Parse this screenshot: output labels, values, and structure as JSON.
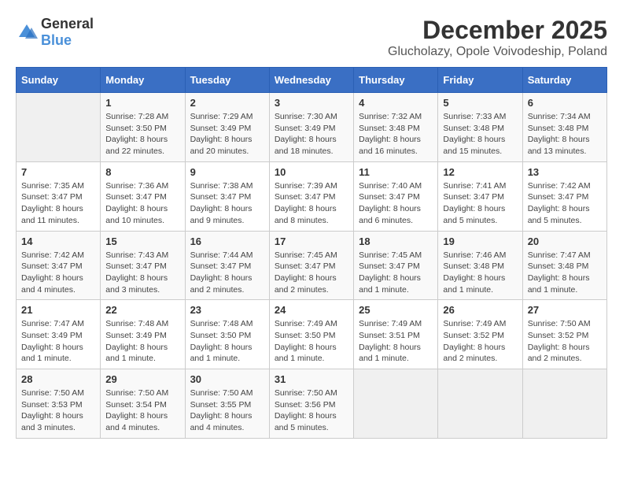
{
  "logo": {
    "general": "General",
    "blue": "Blue"
  },
  "header": {
    "month": "December 2025",
    "location": "Glucholazy, Opole Voivodeship, Poland"
  },
  "days_of_week": [
    "Sunday",
    "Monday",
    "Tuesday",
    "Wednesday",
    "Thursday",
    "Friday",
    "Saturday"
  ],
  "weeks": [
    [
      {
        "day": "",
        "info": ""
      },
      {
        "day": "1",
        "info": "Sunrise: 7:28 AM\nSunset: 3:50 PM\nDaylight: 8 hours and 22 minutes."
      },
      {
        "day": "2",
        "info": "Sunrise: 7:29 AM\nSunset: 3:49 PM\nDaylight: 8 hours and 20 minutes."
      },
      {
        "day": "3",
        "info": "Sunrise: 7:30 AM\nSunset: 3:49 PM\nDaylight: 8 hours and 18 minutes."
      },
      {
        "day": "4",
        "info": "Sunrise: 7:32 AM\nSunset: 3:48 PM\nDaylight: 8 hours and 16 minutes."
      },
      {
        "day": "5",
        "info": "Sunrise: 7:33 AM\nSunset: 3:48 PM\nDaylight: 8 hours and 15 minutes."
      },
      {
        "day": "6",
        "info": "Sunrise: 7:34 AM\nSunset: 3:48 PM\nDaylight: 8 hours and 13 minutes."
      }
    ],
    [
      {
        "day": "7",
        "info": "Sunrise: 7:35 AM\nSunset: 3:47 PM\nDaylight: 8 hours and 11 minutes."
      },
      {
        "day": "8",
        "info": "Sunrise: 7:36 AM\nSunset: 3:47 PM\nDaylight: 8 hours and 10 minutes."
      },
      {
        "day": "9",
        "info": "Sunrise: 7:38 AM\nSunset: 3:47 PM\nDaylight: 8 hours and 9 minutes."
      },
      {
        "day": "10",
        "info": "Sunrise: 7:39 AM\nSunset: 3:47 PM\nDaylight: 8 hours and 8 minutes."
      },
      {
        "day": "11",
        "info": "Sunrise: 7:40 AM\nSunset: 3:47 PM\nDaylight: 8 hours and 6 minutes."
      },
      {
        "day": "12",
        "info": "Sunrise: 7:41 AM\nSunset: 3:47 PM\nDaylight: 8 hours and 5 minutes."
      },
      {
        "day": "13",
        "info": "Sunrise: 7:42 AM\nSunset: 3:47 PM\nDaylight: 8 hours and 5 minutes."
      }
    ],
    [
      {
        "day": "14",
        "info": "Sunrise: 7:42 AM\nSunset: 3:47 PM\nDaylight: 8 hours and 4 minutes."
      },
      {
        "day": "15",
        "info": "Sunrise: 7:43 AM\nSunset: 3:47 PM\nDaylight: 8 hours and 3 minutes."
      },
      {
        "day": "16",
        "info": "Sunrise: 7:44 AM\nSunset: 3:47 PM\nDaylight: 8 hours and 2 minutes."
      },
      {
        "day": "17",
        "info": "Sunrise: 7:45 AM\nSunset: 3:47 PM\nDaylight: 8 hours and 2 minutes."
      },
      {
        "day": "18",
        "info": "Sunrise: 7:45 AM\nSunset: 3:47 PM\nDaylight: 8 hours and 1 minute."
      },
      {
        "day": "19",
        "info": "Sunrise: 7:46 AM\nSunset: 3:48 PM\nDaylight: 8 hours and 1 minute."
      },
      {
        "day": "20",
        "info": "Sunrise: 7:47 AM\nSunset: 3:48 PM\nDaylight: 8 hours and 1 minute."
      }
    ],
    [
      {
        "day": "21",
        "info": "Sunrise: 7:47 AM\nSunset: 3:49 PM\nDaylight: 8 hours and 1 minute."
      },
      {
        "day": "22",
        "info": "Sunrise: 7:48 AM\nSunset: 3:49 PM\nDaylight: 8 hours and 1 minute."
      },
      {
        "day": "23",
        "info": "Sunrise: 7:48 AM\nSunset: 3:50 PM\nDaylight: 8 hours and 1 minute."
      },
      {
        "day": "24",
        "info": "Sunrise: 7:49 AM\nSunset: 3:50 PM\nDaylight: 8 hours and 1 minute."
      },
      {
        "day": "25",
        "info": "Sunrise: 7:49 AM\nSunset: 3:51 PM\nDaylight: 8 hours and 1 minute."
      },
      {
        "day": "26",
        "info": "Sunrise: 7:49 AM\nSunset: 3:52 PM\nDaylight: 8 hours and 2 minutes."
      },
      {
        "day": "27",
        "info": "Sunrise: 7:50 AM\nSunset: 3:52 PM\nDaylight: 8 hours and 2 minutes."
      }
    ],
    [
      {
        "day": "28",
        "info": "Sunrise: 7:50 AM\nSunset: 3:53 PM\nDaylight: 8 hours and 3 minutes."
      },
      {
        "day": "29",
        "info": "Sunrise: 7:50 AM\nSunset: 3:54 PM\nDaylight: 8 hours and 4 minutes."
      },
      {
        "day": "30",
        "info": "Sunrise: 7:50 AM\nSunset: 3:55 PM\nDaylight: 8 hours and 4 minutes."
      },
      {
        "day": "31",
        "info": "Sunrise: 7:50 AM\nSunset: 3:56 PM\nDaylight: 8 hours and 5 minutes."
      },
      {
        "day": "",
        "info": ""
      },
      {
        "day": "",
        "info": ""
      },
      {
        "day": "",
        "info": ""
      }
    ]
  ]
}
